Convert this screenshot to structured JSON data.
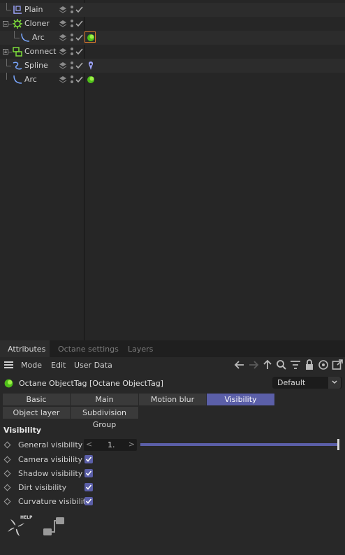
{
  "object_manager": {
    "objects": [
      {
        "name": "Plain",
        "icon": "plain-null-icon"
      },
      {
        "name": "Cloner",
        "icon": "cloner-icon"
      },
      {
        "name": "Arc",
        "icon": "arc-spline-icon"
      },
      {
        "name": "Connect",
        "icon": "connect-icon"
      },
      {
        "name": "Spline",
        "icon": "spline-icon"
      },
      {
        "name": "Arc",
        "icon": "arc-spline-icon"
      }
    ]
  },
  "attributes": {
    "tabs": [
      "Attributes",
      "Octane settings",
      "Layers"
    ],
    "active_tab": "Attributes",
    "menu": [
      "Mode",
      "Edit",
      "User Data"
    ],
    "object_title": "Octane ObjectTag [Octane ObjectTag]",
    "preset_dropdown": "Default",
    "param_tabs_row1": [
      "Basic",
      "Main",
      "Motion blur",
      "Visibility"
    ],
    "param_tabs_row2": [
      "Object layer",
      "Subdivision Group"
    ],
    "active_param_tab": "Visibility",
    "section_title": "Visibility",
    "general_visibility": {
      "label": "General visibility",
      "value": "1.",
      "left_arrow": "<",
      "right_arrow": ">",
      "slider_fraction": 1.0
    },
    "checkbox_params": [
      {
        "label": "Camera visibility",
        "checked": true
      },
      {
        "label": "Shadow visibility",
        "checked": true
      },
      {
        "label": "Dirt visibility",
        "checked": true
      },
      {
        "label": "Curvature visibility",
        "checked": true
      }
    ],
    "help_badge": "HELP",
    "accent_color": "#5b5fa8",
    "selection_color": "#e07b2c"
  }
}
